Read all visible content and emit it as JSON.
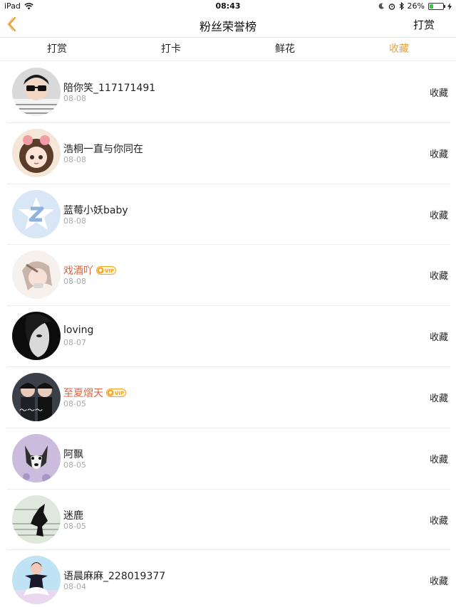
{
  "status_bar": {
    "device": "iPad",
    "time": "08:43",
    "battery": "26%",
    "battery_level": 0.26
  },
  "nav": {
    "title": "粉丝荣誉榜",
    "action_label": "打赏"
  },
  "tabs": [
    {
      "label": "打赏",
      "active": false
    },
    {
      "label": "打卡",
      "active": false
    },
    {
      "label": "鲜花",
      "active": false
    },
    {
      "label": "收藏",
      "active": true
    }
  ],
  "colors": {
    "accent": "#e6a33a",
    "vip_name": "#d9633d",
    "vip_badge": "#f5a623"
  },
  "list": [
    {
      "name": "陪你笑_117171491",
      "date": "08-08",
      "action": "收藏",
      "vip": false,
      "avatar_icon": "avatar-sunglasses-icon",
      "vip_label": ""
    },
    {
      "name": "浩桐一直与你同在",
      "date": "08-08",
      "action": "收藏",
      "vip": false,
      "avatar_icon": "avatar-anime-girl-icon",
      "vip_label": ""
    },
    {
      "name": "蓝莓小妖baby",
      "date": "08-08",
      "action": "收藏",
      "vip": false,
      "avatar_icon": "avatar-default-z-icon",
      "vip_label": ""
    },
    {
      "name": "戏酒吖",
      "date": "08-08",
      "action": "收藏",
      "vip": true,
      "avatar_icon": "avatar-girl-sketch-icon",
      "vip_label": "VIP"
    },
    {
      "name": "loving",
      "date": "08-07",
      "action": "收藏",
      "vip": false,
      "avatar_icon": "avatar-dark-portrait-icon",
      "vip_label": ""
    },
    {
      "name": "至夏熠天",
      "date": "08-05",
      "action": "收藏",
      "vip": true,
      "avatar_icon": "avatar-drama-poster-icon",
      "vip_label": "VIP"
    },
    {
      "name": "阿飘",
      "date": "08-05",
      "action": "收藏",
      "vip": false,
      "avatar_icon": "avatar-husky-dog-icon",
      "vip_label": ""
    },
    {
      "name": "迷鹿",
      "date": "08-05",
      "action": "收藏",
      "vip": false,
      "avatar_icon": "avatar-silhouette-icon",
      "vip_label": ""
    },
    {
      "name": "语晨麻麻_228019377",
      "date": "08-04",
      "action": "收藏",
      "vip": false,
      "avatar_icon": "avatar-child-dancer-icon",
      "vip_label": ""
    }
  ]
}
